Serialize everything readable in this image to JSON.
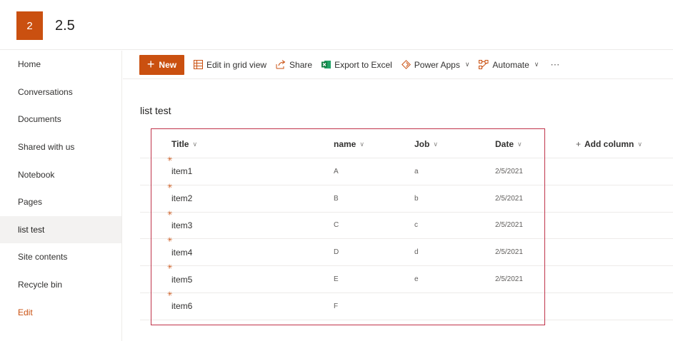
{
  "site": {
    "logo_letter": "2",
    "title": "2.5"
  },
  "nav": {
    "items": [
      {
        "label": "Home"
      },
      {
        "label": "Conversations"
      },
      {
        "label": "Documents"
      },
      {
        "label": "Shared with us"
      },
      {
        "label": "Notebook"
      },
      {
        "label": "Pages"
      },
      {
        "label": "list test",
        "selected": true
      },
      {
        "label": "Site contents"
      },
      {
        "label": "Recycle bin"
      },
      {
        "label": "Edit"
      }
    ]
  },
  "commands": {
    "new_label": "New",
    "grid_label": "Edit in grid view",
    "share_label": "Share",
    "export_label": "Export to Excel",
    "powerapps_label": "Power Apps",
    "automate_label": "Automate",
    "more_label": "⋯"
  },
  "list": {
    "title": "list test",
    "columns": {
      "title": "Title",
      "name": "name",
      "job": "Job",
      "date": "Date",
      "add": "Add column"
    },
    "rows": [
      {
        "title": "item1",
        "name": "A",
        "job": "a",
        "date": "2/5/2021"
      },
      {
        "title": "item2",
        "name": "B",
        "job": "b",
        "date": "2/5/2021"
      },
      {
        "title": "item3",
        "name": "C",
        "job": "c",
        "date": "2/5/2021"
      },
      {
        "title": "item4",
        "name": "D",
        "job": "d",
        "date": "2/5/2021"
      },
      {
        "title": "item5",
        "name": "E",
        "job": "e",
        "date": "2/5/2021"
      },
      {
        "title": "item6",
        "name": "F",
        "job": "",
        "date": ""
      }
    ]
  },
  "colors": {
    "accent": "#ca5010",
    "highlight_border": "#c0334a"
  }
}
